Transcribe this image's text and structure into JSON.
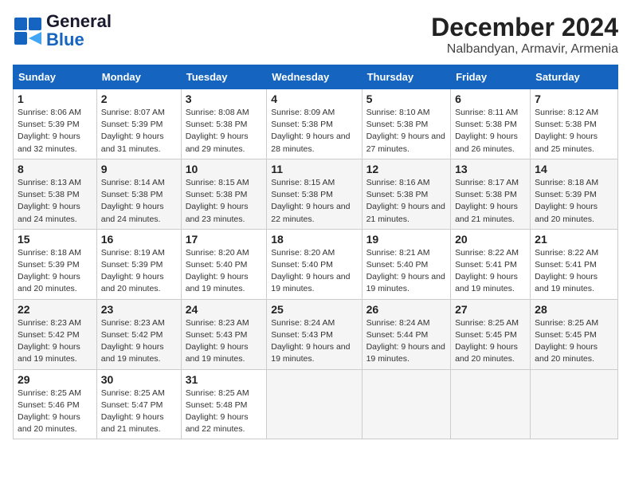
{
  "header": {
    "logo_general": "General",
    "logo_blue": "Blue",
    "title": "December 2024",
    "subtitle": "Nalbandyan, Armavir, Armenia"
  },
  "calendar": {
    "days_of_week": [
      "Sunday",
      "Monday",
      "Tuesday",
      "Wednesday",
      "Thursday",
      "Friday",
      "Saturday"
    ],
    "weeks": [
      [
        {
          "day": 1,
          "sunrise": "8:06 AM",
          "sunset": "5:39 PM",
          "daylight": "9 hours and 32 minutes."
        },
        {
          "day": 2,
          "sunrise": "8:07 AM",
          "sunset": "5:39 PM",
          "daylight": "9 hours and 31 minutes."
        },
        {
          "day": 3,
          "sunrise": "8:08 AM",
          "sunset": "5:38 PM",
          "daylight": "9 hours and 29 minutes."
        },
        {
          "day": 4,
          "sunrise": "8:09 AM",
          "sunset": "5:38 PM",
          "daylight": "9 hours and 28 minutes."
        },
        {
          "day": 5,
          "sunrise": "8:10 AM",
          "sunset": "5:38 PM",
          "daylight": "9 hours and 27 minutes."
        },
        {
          "day": 6,
          "sunrise": "8:11 AM",
          "sunset": "5:38 PM",
          "daylight": "9 hours and 26 minutes."
        },
        {
          "day": 7,
          "sunrise": "8:12 AM",
          "sunset": "5:38 PM",
          "daylight": "9 hours and 25 minutes."
        }
      ],
      [
        {
          "day": 8,
          "sunrise": "8:13 AM",
          "sunset": "5:38 PM",
          "daylight": "9 hours and 24 minutes."
        },
        {
          "day": 9,
          "sunrise": "8:14 AM",
          "sunset": "5:38 PM",
          "daylight": "9 hours and 24 minutes."
        },
        {
          "day": 10,
          "sunrise": "8:15 AM",
          "sunset": "5:38 PM",
          "daylight": "9 hours and 23 minutes."
        },
        {
          "day": 11,
          "sunrise": "8:15 AM",
          "sunset": "5:38 PM",
          "daylight": "9 hours and 22 minutes."
        },
        {
          "day": 12,
          "sunrise": "8:16 AM",
          "sunset": "5:38 PM",
          "daylight": "9 hours and 21 minutes."
        },
        {
          "day": 13,
          "sunrise": "8:17 AM",
          "sunset": "5:38 PM",
          "daylight": "9 hours and 21 minutes."
        },
        {
          "day": 14,
          "sunrise": "8:18 AM",
          "sunset": "5:39 PM",
          "daylight": "9 hours and 20 minutes."
        }
      ],
      [
        {
          "day": 15,
          "sunrise": "8:18 AM",
          "sunset": "5:39 PM",
          "daylight": "9 hours and 20 minutes."
        },
        {
          "day": 16,
          "sunrise": "8:19 AM",
          "sunset": "5:39 PM",
          "daylight": "9 hours and 20 minutes."
        },
        {
          "day": 17,
          "sunrise": "8:20 AM",
          "sunset": "5:40 PM",
          "daylight": "9 hours and 19 minutes."
        },
        {
          "day": 18,
          "sunrise": "8:20 AM",
          "sunset": "5:40 PM",
          "daylight": "9 hours and 19 minutes."
        },
        {
          "day": 19,
          "sunrise": "8:21 AM",
          "sunset": "5:40 PM",
          "daylight": "9 hours and 19 minutes."
        },
        {
          "day": 20,
          "sunrise": "8:22 AM",
          "sunset": "5:41 PM",
          "daylight": "9 hours and 19 minutes."
        },
        {
          "day": 21,
          "sunrise": "8:22 AM",
          "sunset": "5:41 PM",
          "daylight": "9 hours and 19 minutes."
        }
      ],
      [
        {
          "day": 22,
          "sunrise": "8:23 AM",
          "sunset": "5:42 PM",
          "daylight": "9 hours and 19 minutes."
        },
        {
          "day": 23,
          "sunrise": "8:23 AM",
          "sunset": "5:42 PM",
          "daylight": "9 hours and 19 minutes."
        },
        {
          "day": 24,
          "sunrise": "8:23 AM",
          "sunset": "5:43 PM",
          "daylight": "9 hours and 19 minutes."
        },
        {
          "day": 25,
          "sunrise": "8:24 AM",
          "sunset": "5:43 PM",
          "daylight": "9 hours and 19 minutes."
        },
        {
          "day": 26,
          "sunrise": "8:24 AM",
          "sunset": "5:44 PM",
          "daylight": "9 hours and 19 minutes."
        },
        {
          "day": 27,
          "sunrise": "8:25 AM",
          "sunset": "5:45 PM",
          "daylight": "9 hours and 20 minutes."
        },
        {
          "day": 28,
          "sunrise": "8:25 AM",
          "sunset": "5:45 PM",
          "daylight": "9 hours and 20 minutes."
        }
      ],
      [
        {
          "day": 29,
          "sunrise": "8:25 AM",
          "sunset": "5:46 PM",
          "daylight": "9 hours and 20 minutes."
        },
        {
          "day": 30,
          "sunrise": "8:25 AM",
          "sunset": "5:47 PM",
          "daylight": "9 hours and 21 minutes."
        },
        {
          "day": 31,
          "sunrise": "8:25 AM",
          "sunset": "5:48 PM",
          "daylight": "9 hours and 22 minutes."
        },
        null,
        null,
        null,
        null
      ]
    ]
  }
}
